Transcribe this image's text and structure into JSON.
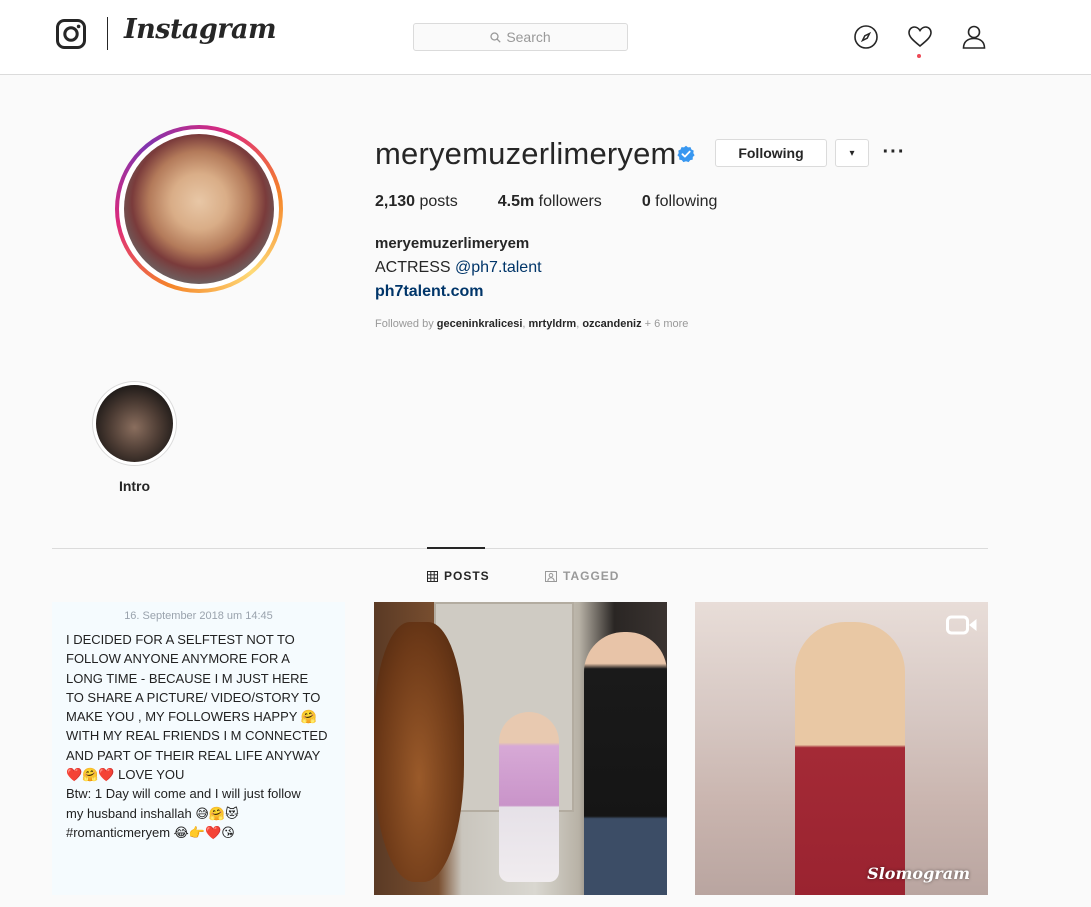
{
  "header": {
    "wordmark": "Instagram",
    "search_placeholder": "Search",
    "icons": [
      "instagram-glyph-icon",
      "compass-icon",
      "heart-icon",
      "user-icon"
    ]
  },
  "profile": {
    "username": "meryemuzerlimeryem",
    "verified": true,
    "following_label": "Following",
    "dropdown_glyph": "▾",
    "more_glyph": "···",
    "stats": {
      "posts_count": "2,130",
      "posts_label": "posts",
      "followers_count": "4.5m",
      "followers_label": "followers",
      "following_count": "0",
      "following_label": "following"
    },
    "bio": {
      "name": "meryemuzerlimeryem",
      "line_prefix": "ACTRESS ",
      "mention": "@ph7.talent",
      "link": "ph7talent.com"
    },
    "followed_by": {
      "prefix": "Followed by ",
      "users": [
        "geceninkralicesi",
        "mrtyldrm",
        "ozcandeniz"
      ],
      "sep": ", ",
      "more": " + 6 more"
    }
  },
  "highlights": [
    {
      "label": "Intro"
    }
  ],
  "tabs": [
    {
      "label": "POSTS",
      "active": true
    },
    {
      "label": "TAGGED",
      "active": false
    }
  ],
  "posts": [
    {
      "date": "16. September 2018 um 14:45",
      "lines": [
        "I DECIDED FOR A SELFTEST NOT TO",
        "FOLLOW ANYONE ANYMORE FOR A",
        "LONG TIME - BECAUSE I M JUST HERE",
        "TO SHARE A PICTURE/ VIDEO/STORY TO",
        "MAKE YOU , MY FOLLOWERS HAPPY 🤗",
        "WITH MY REAL FRIENDS I M CONNECTED",
        "AND PART OF THEIR REAL LIFE ANYWAY",
        "❤️🤗❤️ LOVE YOU",
        "Btw: 1 Day will come and I will just follow",
        "my husband inshallah 😅🤗😻",
        "#romanticmeryem 😂👉❤️😘"
      ]
    },
    {
      "type": "photo"
    },
    {
      "type": "video",
      "watermark": "Slomogram"
    }
  ],
  "colors": {
    "link": "#003569",
    "verified": "#3897f0",
    "notification": "#ed4956"
  }
}
